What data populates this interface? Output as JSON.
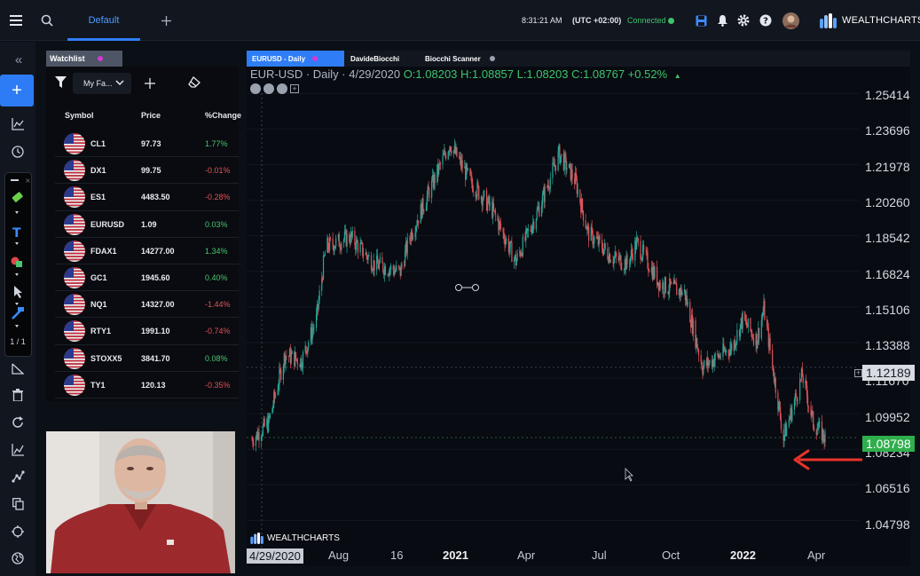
{
  "topbar": {
    "tab_default": "Default",
    "clock": "8:31:21 AM",
    "timezone": "(UTC +02:00)",
    "connection": "Connected",
    "brand": "WEALTHCHARTS",
    "icons": [
      "menu-icon",
      "search-icon",
      "plus-icon",
      "save-icon",
      "bell-icon",
      "gear-icon",
      "help-icon",
      "avatar"
    ]
  },
  "left_tools": {
    "collapse": "«",
    "add": "+",
    "pager": "1 / 1"
  },
  "watchlist": {
    "tab_label": "Watchlist",
    "select_value": "My Fa...",
    "columns": [
      "Symbol",
      "Price",
      "%Change"
    ],
    "rows": [
      {
        "symbol": "CL1",
        "price": "97.73",
        "change": "1.77%",
        "dir": "pos"
      },
      {
        "symbol": "DX1",
        "price": "99.75",
        "change": "-0.01%",
        "dir": "neg"
      },
      {
        "symbol": "ES1",
        "price": "4483.50",
        "change": "-0.28%",
        "dir": "neg"
      },
      {
        "symbol": "EURUSD",
        "price": "1.09",
        "change": "0.03%",
        "dir": "pos"
      },
      {
        "symbol": "FDAX1",
        "price": "14277.00",
        "change": "1.34%",
        "dir": "pos"
      },
      {
        "symbol": "GC1",
        "price": "1945.60",
        "change": "0.40%",
        "dir": "pos"
      },
      {
        "symbol": "NQ1",
        "price": "14327.00",
        "change": "-1.44%",
        "dir": "neg"
      },
      {
        "symbol": "RTY1",
        "price": "1991.10",
        "change": "-0.74%",
        "dir": "neg"
      },
      {
        "symbol": "STOXX5",
        "price": "3841.70",
        "change": "0.08%",
        "dir": "pos"
      },
      {
        "symbol": "TY1",
        "price": "120.13",
        "change": "-0.35%",
        "dir": "neg"
      }
    ]
  },
  "chart_tabs": [
    {
      "label": "EURUSD - Daily",
      "dot": "#d13bd4"
    },
    {
      "label": "DavideBiocchi",
      "dot": ""
    },
    {
      "label": "Biocchi Scanner",
      "dot": "#9aa2b0"
    }
  ],
  "chart": {
    "legend_prefix": "EUR-USD · Daily · 4/29/2020",
    "ohlc": "O:1.08203 H:1.08857 L:1.08203 C:1.08767 +0.52%",
    "last_price": "1.08798",
    "crosshair_price": "1.12189",
    "watermark": "WEALTHCHARTS",
    "first_date_label": "4/29/2020",
    "y_ticks": [
      "1.25414",
      "1.23696",
      "1.21978",
      "1.20260",
      "1.18542",
      "1.16824",
      "1.15106",
      "1.13388",
      "1.11670",
      "1.09952",
      "1.08234",
      "1.06516",
      "1.04798"
    ],
    "x_ticks": [
      {
        "label": "Aug",
        "bold": false
      },
      {
        "label": "16",
        "bold": false
      },
      {
        "label": "2021",
        "bold": true
      },
      {
        "label": "Apr",
        "bold": false
      },
      {
        "label": "Jul",
        "bold": false
      },
      {
        "label": "Oct",
        "bold": false
      },
      {
        "label": "2022",
        "bold": true
      },
      {
        "label": "Apr",
        "bold": false
      }
    ],
    "colors": {
      "up": "#27a89a",
      "down": "#e0535a",
      "arrow": "#e8332b"
    }
  },
  "chart_data": {
    "type": "candlestick",
    "symbol": "EUR-USD",
    "interval": "Daily",
    "ylim": [
      1.04,
      1.262
    ],
    "y_tick_values": [
      1.25414,
      1.23696,
      1.21978,
      1.2026,
      1.18542,
      1.16824,
      1.15106,
      1.13388,
      1.1167,
      1.09952,
      1.08234,
      1.06516,
      1.04798
    ],
    "x": [
      "2020-04-29",
      "2020-05-20",
      "2020-06-10",
      "2020-07-01",
      "2020-07-20",
      "2020-08-01",
      "2020-09-01",
      "2020-10-01",
      "2020-11-04",
      "2020-11-16",
      "2021-01-06",
      "2021-02-01",
      "2021-03-01",
      "2021-03-31",
      "2021-05-01",
      "2021-05-25",
      "2021-06-15",
      "2021-07-01",
      "2021-08-01",
      "2021-08-20",
      "2021-09-01",
      "2021-10-01",
      "2021-11-01",
      "2021-11-24",
      "2022-01-01",
      "2022-01-14",
      "2022-02-01",
      "2022-02-10",
      "2022-03-07",
      "2022-03-31",
      "2022-04-14",
      "2022-04-29"
    ],
    "close": [
      1.087,
      1.095,
      1.128,
      1.125,
      1.145,
      1.18,
      1.185,
      1.172,
      1.168,
      1.185,
      1.23,
      1.212,
      1.198,
      1.173,
      1.2,
      1.225,
      1.212,
      1.187,
      1.175,
      1.172,
      1.182,
      1.162,
      1.158,
      1.122,
      1.132,
      1.145,
      1.135,
      1.15,
      1.088,
      1.118,
      1.095,
      1.088
    ],
    "last_price": 1.08798,
    "crosshair_price": 1.12189
  }
}
